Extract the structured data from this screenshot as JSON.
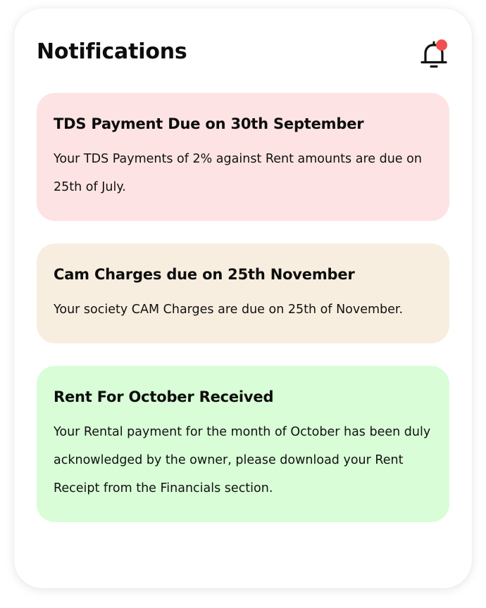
{
  "header": {
    "title": "Notifications",
    "icon": "bell-icon",
    "has_unread": true,
    "unread_color": "#f05050"
  },
  "notifications": [
    {
      "title": "TDS Payment Due on 30th September",
      "body": "Your TDS Payments of 2% against Rent amounts are due on 25th of July.",
      "background": "#fde3e3"
    },
    {
      "title": "Cam Charges due on 25th November",
      "body": "Your society CAM Charges are due on 25th of November.",
      "background": "#f8eedf"
    },
    {
      "title": "Rent For October Received",
      "body": "Your Rental payment for the month of October has been duly acknowledged by the owner, please download your Rent Receipt from the Financials section.",
      "background": "#d8fdd7"
    }
  ]
}
